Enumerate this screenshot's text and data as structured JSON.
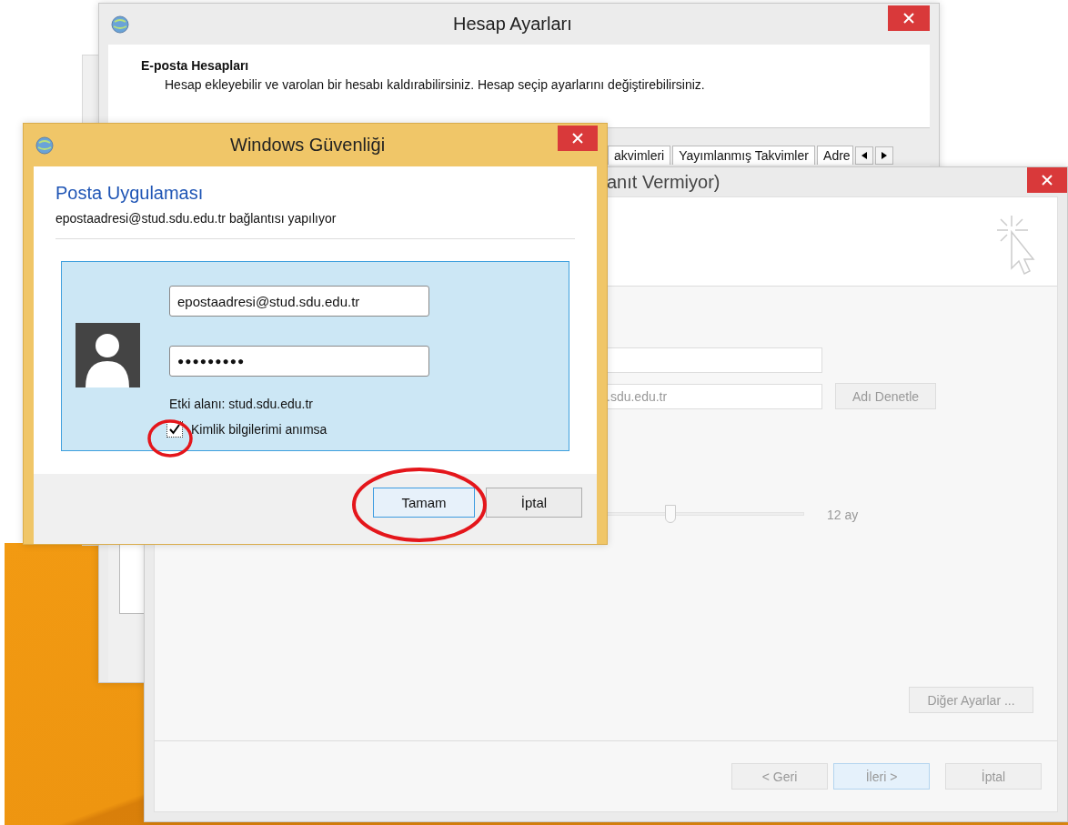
{
  "account_settings": {
    "title": "Hesap Ayarları",
    "heading": "E-posta Hesapları",
    "description": "Hesap ekleyebilir ve varolan bir hesabı kaldırabilirsiniz. Hesap seçip ayarlarını değiştirebilirsiniz.",
    "tabs": [
      {
        "label": "akvimleri"
      },
      {
        "label": "Yayımlanmış Takvimler"
      },
      {
        "label": "Adre"
      }
    ]
  },
  "wizard": {
    "title": "anıt Vermiyor)",
    "server_value": ".sdu.edu.tr",
    "check_name_button": "Adı Denetle",
    "slider": {
      "level": 0.34,
      "reading": "12 ay"
    },
    "more_settings_button": "Diğer Ayarlar ...",
    "buttons": [
      {
        "label": "< Geri",
        "default": false
      },
      {
        "label": "İleri >",
        "default": true
      },
      {
        "label": "İptal",
        "default": false
      }
    ]
  },
  "security": {
    "title": "Windows Güvenliği",
    "app_name": "Posta Uygulaması",
    "message": "epostaadresi@stud.sdu.edu.tr bağlantısı yapılıyor",
    "username": "epostaadresi@stud.sdu.edu.tr",
    "password": "●●●●●●●●●",
    "domain": "Etki alanı: stud.sdu.edu.tr",
    "remember": {
      "label": "Kimlik bilgilerimi anımsa",
      "checked": true
    },
    "buttons": [
      {
        "label": "Tamam",
        "default": true
      },
      {
        "label": "İptal",
        "default": false
      }
    ]
  }
}
